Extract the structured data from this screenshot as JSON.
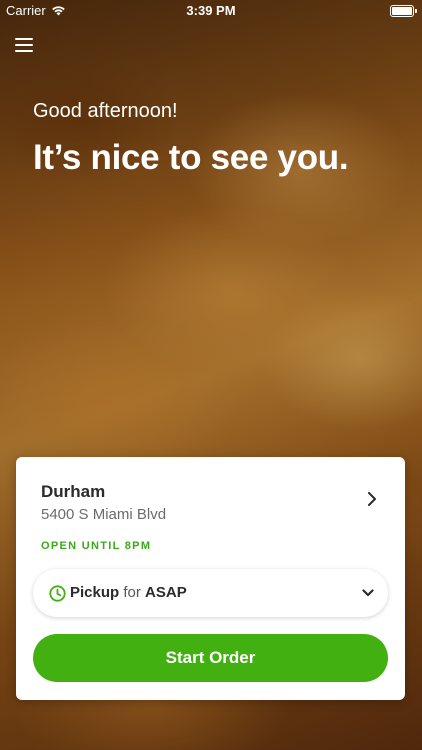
{
  "status_bar": {
    "carrier": "Carrier",
    "time": "3:39 PM",
    "icons": [
      "wifi-icon",
      "battery-icon"
    ]
  },
  "header": {
    "menu_icon": "hamburger-menu-icon"
  },
  "hero": {
    "greeting": "Good afternoon!",
    "headline": "It’s nice to see you."
  },
  "location": {
    "name": "Durham",
    "address": "5400 S Miami Blvd",
    "hours": "OPEN UNTIL 8PM",
    "chevron_icon": "chevron-right-icon"
  },
  "order_mode": {
    "icon": "clock-icon",
    "mode": "Pickup",
    "connector": "for",
    "time": "ASAP",
    "dropdown_icon": "chevron-down-icon"
  },
  "actions": {
    "start_order": "Start Order"
  },
  "colors": {
    "accent_green": "#43b012",
    "hours_green": "#3aaa1a"
  }
}
